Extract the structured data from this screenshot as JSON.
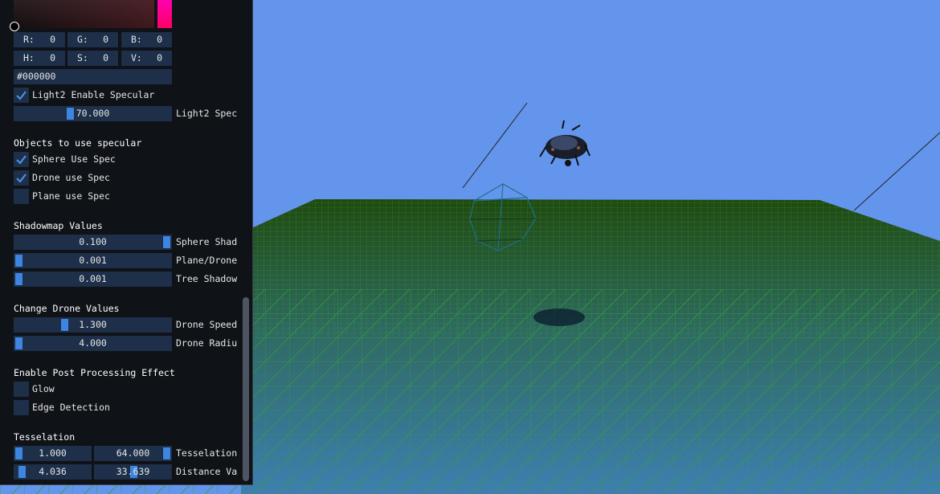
{
  "panel": {
    "rgb": [
      {
        "label": "R:",
        "value": "0"
      },
      {
        "label": "G:",
        "value": "0"
      },
      {
        "label": "B:",
        "value": "0"
      }
    ],
    "hsv": [
      {
        "label": "H:",
        "value": "0"
      },
      {
        "label": "S:",
        "value": "0"
      },
      {
        "label": "V:",
        "value": "0"
      }
    ],
    "hex_value": "#000000",
    "light2_enable_specular": {
      "label": "Light2 Enable Specular",
      "checked": true
    },
    "light2_spec": {
      "value": "70.000",
      "label": "Light2 Spec"
    },
    "objects_section": "Objects to use specular",
    "sphere_use_spec": {
      "label": "Sphere Use Spec",
      "checked": true
    },
    "drone_use_spec": {
      "label": "Drone use Spec",
      "checked": true
    },
    "plane_use_spec": {
      "label": "Plane use Spec",
      "checked": false
    },
    "shadowmap_section": "Shadowmap Values",
    "sphere_shadow": {
      "value": "0.100",
      "label": "Sphere Shad"
    },
    "plane_drone_shadow": {
      "value": "0.001",
      "label": "Plane/Drone"
    },
    "tree_shadow": {
      "value": "0.001",
      "label": "Tree Shadow"
    },
    "drone_section": "Change Drone Values",
    "drone_speed": {
      "value": "1.300",
      "label": "Drone Speed"
    },
    "drone_radius": {
      "value": "4.000",
      "label": "Drone Radiu"
    },
    "post_section": "Enable Post Processing Effect",
    "glow": {
      "label": "Glow",
      "checked": false
    },
    "edge_detection": {
      "label": "Edge Detection",
      "checked": false
    },
    "tess_section": "Tesselation",
    "tess_a": {
      "value": "1.000"
    },
    "tess_b": {
      "value": "64.000"
    },
    "tess_label": "Tesselation",
    "dist_a": {
      "value": "4.036"
    },
    "dist_b": {
      "value": "33.639"
    },
    "dist_label": "Distance Va"
  },
  "colors": {
    "sky": "#6495ed",
    "panel_bg": "#0f1217",
    "widget_bg": "#1d2f49",
    "accent": "#3d85e0",
    "grid": "#2e8b3a"
  }
}
